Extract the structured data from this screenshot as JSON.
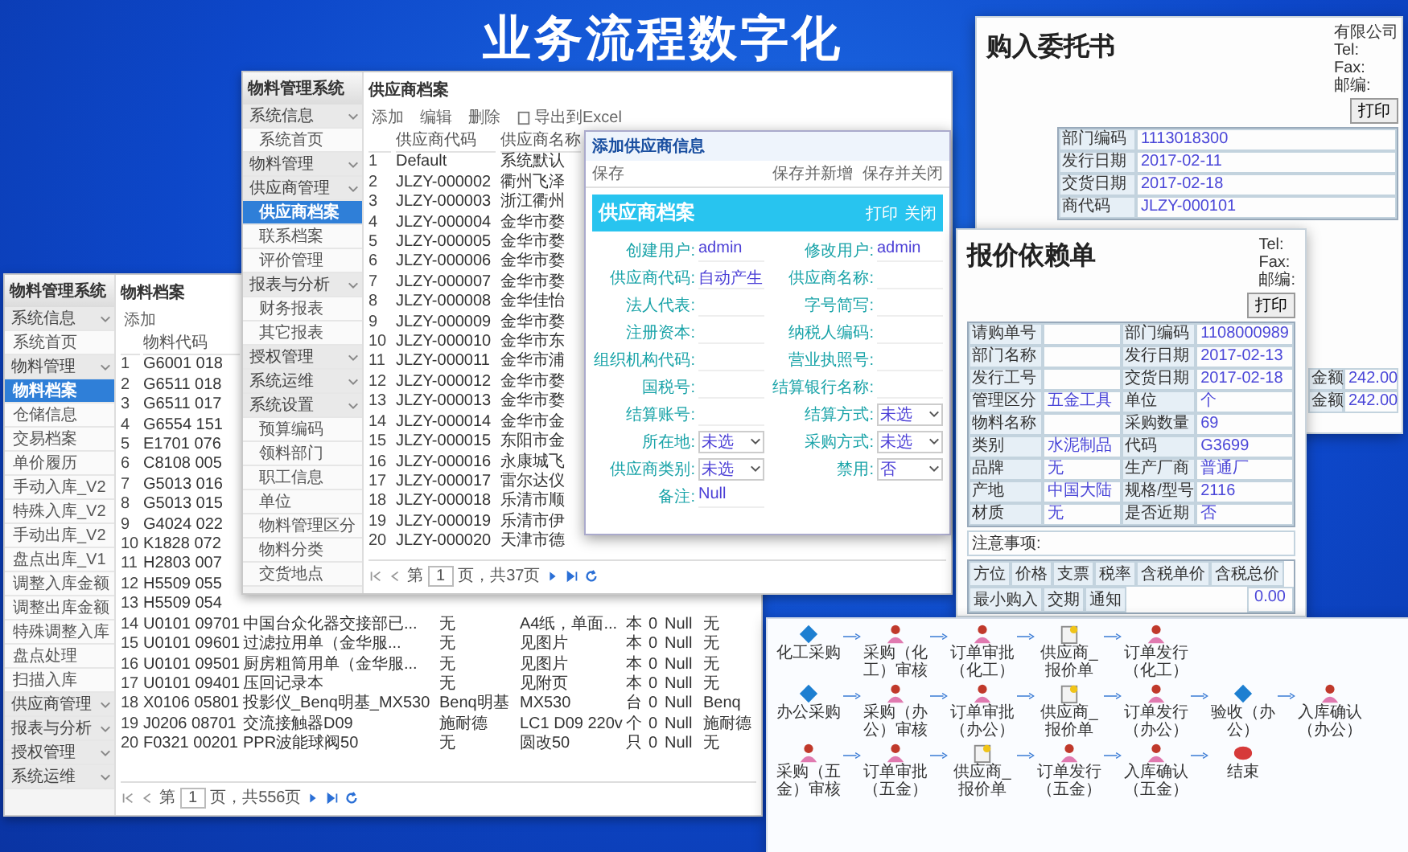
{
  "banner": {
    "title": "业务流程数字化"
  },
  "windows": [
    {
      "app_title": "物料管理系统",
      "page_title": "物料档案",
      "sidebar": [
        {
          "label": "系统信息",
          "kind": "group",
          "selected": false
        },
        {
          "label": "系统首页",
          "kind": "item",
          "selected": false
        },
        {
          "label": "物料管理",
          "kind": "group",
          "selected": false
        },
        {
          "label": "物料档案",
          "kind": "item",
          "selected": true
        },
        {
          "label": "仓储信息",
          "kind": "item",
          "selected": false
        },
        {
          "label": "交易档案",
          "kind": "item",
          "selected": false
        },
        {
          "label": "单价履历",
          "kind": "item",
          "selected": false
        },
        {
          "label": "手动入库_V2",
          "kind": "item",
          "selected": false
        },
        {
          "label": "特殊入库_V2",
          "kind": "item",
          "selected": false
        },
        {
          "label": "手动出库_V2",
          "kind": "item",
          "selected": false
        },
        {
          "label": "盘点出库_V1",
          "kind": "item",
          "selected": false
        },
        {
          "label": "调整入库金额",
          "kind": "item",
          "selected": false
        },
        {
          "label": "调整出库金额",
          "kind": "item",
          "selected": false
        },
        {
          "label": "特殊调整入库",
          "kind": "item",
          "selected": false
        },
        {
          "label": "盘点处理",
          "kind": "item",
          "selected": false
        },
        {
          "label": "扫描入库",
          "kind": "item",
          "selected": false
        },
        {
          "label": "供应商管理",
          "kind": "group",
          "selected": false
        },
        {
          "label": "报表与分析",
          "kind": "group",
          "selected": false
        },
        {
          "label": "授权管理",
          "kind": "group",
          "selected": false
        },
        {
          "label": "系统运维",
          "kind": "group",
          "selected": false
        }
      ],
      "toolbar": [
        {
          "label": "添加",
          "kind": "plain"
        }
      ],
      "columns": [
        "物料代码"
      ],
      "rows": [
        {
          "number": "1",
          "cells": [
            "G6001 018"
          ]
        },
        {
          "number": "2",
          "cells": [
            "G6511 018"
          ]
        },
        {
          "number": "3",
          "cells": [
            "G6511 017"
          ]
        },
        {
          "number": "4",
          "cells": [
            "G6554 151"
          ]
        },
        {
          "number": "5",
          "cells": [
            "E1701 076"
          ]
        },
        {
          "number": "6",
          "cells": [
            "C8108 005"
          ]
        },
        {
          "number": "7",
          "cells": [
            "G5013 016"
          ]
        },
        {
          "number": "8",
          "cells": [
            "G5013 015"
          ]
        },
        {
          "number": "9",
          "cells": [
            "G4024 022"
          ]
        },
        {
          "number": "10",
          "cells": [
            "K1828 072"
          ]
        },
        {
          "number": "11",
          "cells": [
            "H2803 007"
          ]
        },
        {
          "number": "12",
          "cells": [
            "H5509 055"
          ]
        },
        {
          "number": "13",
          "cells": [
            "H5509 054"
          ]
        },
        {
          "number": "14",
          "cells": [
            "U0101 09701",
            "中国台众化器交接部已...",
            "无",
            "A4纸，单面...",
            "本",
            "0",
            "Null",
            "无"
          ]
        },
        {
          "number": "15",
          "cells": [
            "U0101 09601",
            "过滤拉用单（金华服...",
            "无",
            "见图片",
            "本",
            "0",
            "Null",
            "无"
          ]
        },
        {
          "number": "16",
          "cells": [
            "U0101 09501",
            "厨房粗筒用单（金华服...",
            "无",
            "见图片",
            "本",
            "0",
            "Null",
            "无"
          ]
        },
        {
          "number": "17",
          "cells": [
            "U0101 09401",
            "压回记录本",
            "无",
            "见附页",
            "本",
            "0",
            "Null",
            "无"
          ]
        },
        {
          "number": "18",
          "cells": [
            "X0106 05801",
            "投影仪_Benq明基_MX530",
            "Benq明基",
            "MX530",
            "台",
            "0",
            "Null",
            "Benq"
          ]
        },
        {
          "number": "19",
          "cells": [
            "J0206 08701",
            "交流接触器D09",
            "施耐德",
            "LC1 D09 220v",
            "个",
            "0",
            "Null",
            "施耐德"
          ]
        },
        {
          "number": "20",
          "cells": [
            "F0321 00201",
            "PPR波能球阀50",
            "无",
            "圆改50",
            "只",
            "0",
            "Null",
            "无"
          ]
        }
      ],
      "pager": {
        "prefix": "第",
        "page": "1",
        "suffix": "页，共556页"
      }
    },
    {
      "app_title": "物料管理系统",
      "page_title": "供应商档案",
      "sidebar": [
        {
          "label": "系统信息",
          "kind": "group",
          "selected": false
        },
        {
          "label": "系统首页",
          "kind": "item",
          "selected": false
        },
        {
          "label": "物料管理",
          "kind": "group",
          "selected": false
        },
        {
          "label": "供应商管理",
          "kind": "group",
          "selected": false
        },
        {
          "label": "供应商档案",
          "kind": "item",
          "selected": true
        },
        {
          "label": "联系档案",
          "kind": "item",
          "selected": false
        },
        {
          "label": "评价管理",
          "kind": "item",
          "selected": false
        },
        {
          "label": "报表与分析",
          "kind": "group",
          "selected": false
        },
        {
          "label": "财务报表",
          "kind": "item",
          "selected": false
        },
        {
          "label": "其它报表",
          "kind": "item",
          "selected": false
        },
        {
          "label": "授权管理",
          "kind": "group",
          "selected": false
        },
        {
          "label": "系统运维",
          "kind": "group",
          "selected": false
        },
        {
          "label": "系统设置",
          "kind": "group",
          "selected": false
        },
        {
          "label": "预算编码",
          "kind": "item",
          "selected": false
        },
        {
          "label": "领料部门",
          "kind": "item",
          "selected": false
        },
        {
          "label": "职工信息",
          "kind": "item",
          "selected": false
        },
        {
          "label": "单位",
          "kind": "item",
          "selected": false
        },
        {
          "label": "物料管理区分",
          "kind": "item",
          "selected": false
        },
        {
          "label": "物料分类",
          "kind": "item",
          "selected": false
        },
        {
          "label": "交货地点",
          "kind": "item",
          "selected": false
        }
      ],
      "toolbar": [
        {
          "label": "添加",
          "kind": "plain"
        },
        {
          "label": "编辑",
          "kind": "plain"
        },
        {
          "label": "删除",
          "kind": "plain"
        },
        {
          "label": "导出到Excel",
          "kind": "export"
        }
      ],
      "columns": [
        "供应商代码",
        "供应商名称"
      ],
      "rows": [
        {
          "number": "1",
          "cells": [
            "Default",
            "系统默认"
          ]
        },
        {
          "number": "2",
          "cells": [
            "JLZY-000002",
            "衢州飞泽"
          ]
        },
        {
          "number": "3",
          "cells": [
            "JLZY-000003",
            "浙江衢州"
          ]
        },
        {
          "number": "4",
          "cells": [
            "JLZY-000004",
            "金华市婺"
          ]
        },
        {
          "number": "5",
          "cells": [
            "JLZY-000005",
            "金华市婺"
          ]
        },
        {
          "number": "6",
          "cells": [
            "JLZY-000006",
            "金华市婺"
          ]
        },
        {
          "number": "7",
          "cells": [
            "JLZY-000007",
            "金华市婺"
          ]
        },
        {
          "number": "8",
          "cells": [
            "JLZY-000008",
            "金华佳怡"
          ]
        },
        {
          "number": "9",
          "cells": [
            "JLZY-000009",
            "金华市婺"
          ]
        },
        {
          "number": "10",
          "cells": [
            "JLZY-000010",
            "金华市东"
          ]
        },
        {
          "number": "11",
          "cells": [
            "JLZY-000011",
            "金华市浦"
          ]
        },
        {
          "number": "12",
          "cells": [
            "JLZY-000012",
            "金华市婺"
          ]
        },
        {
          "number": "13",
          "cells": [
            "JLZY-000013",
            "金华市婺"
          ]
        },
        {
          "number": "14",
          "cells": [
            "JLZY-000014",
            "金华市金"
          ]
        },
        {
          "number": "15",
          "cells": [
            "JLZY-000015",
            "东阳市金"
          ]
        },
        {
          "number": "16",
          "cells": [
            "JLZY-000016",
            "永康城飞"
          ]
        },
        {
          "number": "17",
          "cells": [
            "JLZY-000017",
            "雷尔达仪"
          ]
        },
        {
          "number": "18",
          "cells": [
            "JLZY-000018",
            "乐清市顺"
          ]
        },
        {
          "number": "19",
          "cells": [
            "JLZY-000019",
            "乐清市伊"
          ]
        },
        {
          "number": "20",
          "cells": [
            "JLZY-000020",
            "天津市德"
          ]
        }
      ],
      "pager": {
        "prefix": "第",
        "page": "1",
        "suffix": "页，共37页"
      }
    }
  ],
  "dialog": {
    "title": "添加供应商信息",
    "save": "保存",
    "actions": [
      "保存并新增",
      "保存并关闭"
    ],
    "form_title": "供应商档案",
    "form_actions": [
      "打印",
      "关闭"
    ],
    "left_fields": [
      {
        "label": "创建用户:",
        "value": "admin",
        "kind": "text"
      },
      {
        "label": "供应商代码:",
        "value": "自动产生",
        "kind": "text"
      },
      {
        "label": "法人代表:",
        "kind": "text"
      },
      {
        "label": "注册资本:",
        "kind": "text"
      },
      {
        "label": "组织机构代码:",
        "kind": "text"
      },
      {
        "label": "国税号:",
        "kind": "text"
      },
      {
        "label": "结算账号:",
        "kind": "text"
      },
      {
        "label": "所在地:",
        "value": "未选",
        "kind": "select"
      },
      {
        "label": "供应商类别:",
        "value": "未选",
        "kind": "select"
      },
      {
        "label": "备注:",
        "value": "Null",
        "kind": "text"
      }
    ],
    "right_fields": [
      {
        "label": "修改用户:",
        "value": "admin",
        "kind": "text"
      },
      {
        "label": "供应商名称:",
        "kind": "text"
      },
      {
        "label": "字号简写:",
        "kind": "text"
      },
      {
        "label": "纳税人编码:",
        "kind": "text"
      },
      {
        "label": "营业执照号:",
        "kind": "text"
      },
      {
        "label": "结算银行名称:",
        "kind": "text"
      },
      {
        "label": "结算方式:",
        "value": "未选",
        "kind": "select"
      },
      {
        "label": "采购方式:",
        "value": "未选",
        "kind": "select"
      },
      {
        "label": "禁用:",
        "value": "否",
        "kind": "select"
      }
    ]
  },
  "documents": [
    {
      "title": "购入委托书",
      "company": [
        "有限公司",
        "Tel:",
        "Fax:",
        "邮编:"
      ],
      "print": "打印",
      "fields": [
        {
          "label": "部门编码",
          "value": "1113018300"
        },
        {
          "label": "发行日期",
          "value": "2017-02-11"
        },
        {
          "label": "交货日期",
          "value": "2017-02-18"
        },
        {
          "label": "商代码",
          "value": "JLZY-000101"
        }
      ],
      "side": [
        {
          "label": "金额",
          "value": "242.00"
        },
        {
          "label": "金额",
          "value": "242.00"
        }
      ]
    },
    {
      "title": "报价依赖单",
      "company": [
        "Tel:",
        "Fax:",
        "邮编:"
      ],
      "print": "打印",
      "fields": [
        {
          "label": "请购单号"
        },
        {
          "label": "部门编码",
          "value": "1108000989"
        },
        {
          "label": "部门名称"
        },
        {
          "label": "发行日期",
          "value": "2017-02-13"
        },
        {
          "label": "发行工号"
        },
        {
          "label": "交货日期",
          "value": "2017-02-18"
        },
        {
          "label": "管理区分",
          "value": "五金工具"
        },
        {
          "label": "单位",
          "value": "个"
        },
        {
          "label": "物料名称"
        },
        {
          "label": "采购数量",
          "value": "69"
        },
        {
          "label": "类别",
          "value": "水泥制品"
        },
        {
          "label": "代码",
          "value": "G3699"
        },
        {
          "label": "品牌",
          "value": "无"
        },
        {
          "label": "生产厂商",
          "value": "普通厂"
        },
        {
          "label": "产地",
          "value": "中国大陆"
        },
        {
          "label": "规格/型号",
          "value": "2116"
        },
        {
          "label": "材质",
          "value": "无"
        },
        {
          "label": "是否近期",
          "value": "否"
        }
      ],
      "note": "注意事项:",
      "table": {
        "columns": [
          "方位",
          "价格",
          "支票",
          "税率",
          "含税单价",
          "含税总价",
          "最小购入",
          "交期",
          "通知"
        ],
        "cells": [
          "0.00"
        ]
      }
    }
  ],
  "flow": {
    "rows": [
      [
        {
          "label": "化工采购",
          "kind": "decision"
        },
        {
          "label": "采购（化工）审核",
          "kind": "person"
        },
        {
          "label": "订单审批（化工）",
          "kind": "person"
        },
        {
          "label": "供应商_报价单",
          "kind": "doc"
        },
        {
          "label": "订单发行（化工）",
          "kind": "person"
        }
      ],
      [
        {
          "label": "办公采购",
          "kind": "decision"
        },
        {
          "label": "采购（办公）审核",
          "kind": "person"
        },
        {
          "label": "订单审批（办公）",
          "kind": "person"
        },
        {
          "label": "供应商_报价单",
          "kind": "doc"
        },
        {
          "label": "订单发行（办公）",
          "kind": "person"
        },
        {
          "label": "验收（办公）",
          "kind": "decision"
        },
        {
          "label": "入库确认（办公）",
          "kind": "person"
        }
      ],
      [
        {
          "label": "采购（五金）审核",
          "kind": "person"
        },
        {
          "label": "订单审批（五金）",
          "kind": "person"
        },
        {
          "label": "供应商_报价单",
          "kind": "doc"
        },
        {
          "label": "订单发行（五金）",
          "kind": "person"
        },
        {
          "label": "入库确认（五金）",
          "kind": "person"
        },
        {
          "label": "结束",
          "kind": "end"
        }
      ]
    ]
  }
}
